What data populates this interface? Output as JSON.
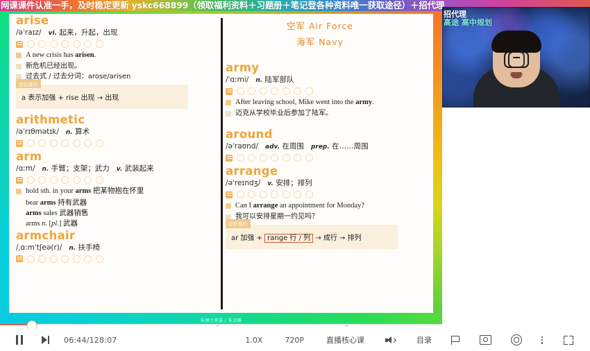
{
  "ad_banner": {
    "text": "网课课件认准一手，及时稳定更新 yskc668899（领取福利资料＋习题册＋笔记登各种资料唯一获取途径）＋招代理"
  },
  "webcam": {
    "overlay_line1": "招代理",
    "overlay_line2": "高途 高中规划"
  },
  "slide": {
    "watermark": "朱博士英语 / 朱汉群",
    "left_column": {
      "entries": [
        {
          "word": "arise",
          "ipa": "/əˈraɪz/",
          "pos": "vi.",
          "meaning": "起来，升起，出现",
          "dots": 7,
          "examples": [
            {
              "type": "en",
              "text_parts": [
                "A new crisis has ",
                "arisen",
                "."
              ]
            },
            {
              "type": "cn",
              "text": "新危机已经出现。"
            },
            {
              "type": "note",
              "text": "过去式 / 过去分词：arose/arisen"
            }
          ],
          "tip": {
            "badge": "记忆技巧",
            "text": "a 表示加强 + rise 出现 → 出现"
          }
        },
        {
          "word": "arithmetic",
          "ipa": "/əˈrɪθmətɪk/",
          "pos": "n.",
          "meaning": "算术",
          "dots": 7,
          "examples": [],
          "tip": null
        },
        {
          "word": "arm",
          "ipa": "/ɑːm/",
          "pos": "n.",
          "meaning": "手臂；支架；武力",
          "pos2": "v.",
          "meaning2": "武装起来",
          "dots": 7,
          "phrases": [
            {
              "parts": [
                "hold sth. in your ",
                "arms",
                " 把某物抱在怀里"
              ]
            },
            {
              "parts": [
                "bear ",
                "arms",
                " 持有武器"
              ]
            },
            {
              "parts": [
                "",
                "arms",
                " sales 武器销售"
              ]
            },
            {
              "parts": [
                "arms n. [pl.] 武器"
              ]
            }
          ],
          "tip": null
        },
        {
          "word": "armchair",
          "ipa": "/ˌɑːmˈtʃeə(r)/",
          "pos": "n.",
          "meaning": "扶手椅",
          "dots": 7,
          "examples": [],
          "tip": null
        }
      ]
    },
    "right_column": {
      "header_lines": [
        "空军 Air Force",
        "海军 Navy"
      ],
      "entries": [
        {
          "word": "army",
          "ipa": "/ˈɑːmi/",
          "pos": "n.",
          "meaning": "陆军部队",
          "dots": 7,
          "examples": [
            {
              "type": "en",
              "text_parts": [
                "After leaving school, Mike went into the ",
                "army",
                "."
              ]
            },
            {
              "type": "cn",
              "text": "迈克从学校毕业后参加了陆军。"
            }
          ],
          "tip": null
        },
        {
          "word": "around",
          "ipa": "/əˈraʊnd/",
          "pos": "adv.",
          "meaning": "在周围",
          "pos2": "prep.",
          "meaning2": "在……周围",
          "dots": 7,
          "examples": [],
          "tip": null
        },
        {
          "word": "arrange",
          "ipa": "/əˈreɪndʒ/",
          "pos": "v.",
          "meaning": "安排；排列",
          "dots": 7,
          "examples": [
            {
              "type": "en",
              "text_parts": [
                "Can I ",
                "arrange",
                " an appointment for Monday?"
              ]
            },
            {
              "type": "cn",
              "text": "我可以安排星期一约见吗？"
            }
          ],
          "tip": {
            "badge": "记忆技巧",
            "pre": "ar 加强 + ",
            "boxed": "range 行 / 列",
            "post": " → 成行 → 排列"
          }
        }
      ]
    }
  },
  "player": {
    "current_time": "06:44",
    "total_time": "128:07",
    "time_display": "06:44/128:07",
    "progress_percent": 7,
    "speed_label": "1.0X",
    "quality_label": "720P",
    "course_label": "直播核心课",
    "catalog_label": "目录",
    "icons": {
      "pause": "pause-icon",
      "next": "next-track-icon",
      "volume": "volume-icon",
      "flag": "flag-icon",
      "camera": "camera-icon",
      "eye": "eye-icon",
      "more": "more-vertical-icon",
      "fullscreen": "fullscreen-icon"
    }
  },
  "colors": {
    "word_orange": "#f0a43c",
    "tip_bg": "#fbf0dd",
    "tip_badge": "#f0c98a",
    "boxed_border": "#cf5a34",
    "progress_played": "#cf6b4a"
  }
}
